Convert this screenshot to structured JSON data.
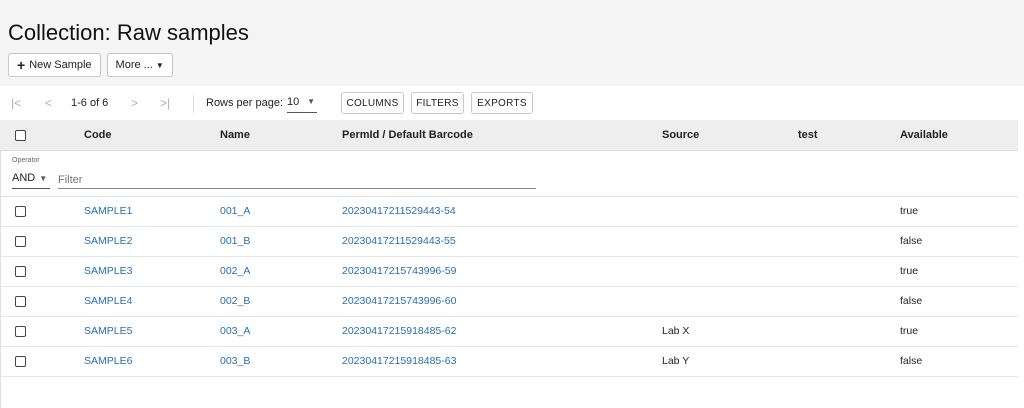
{
  "page": {
    "title": "Collection: Raw samples",
    "new_sample_label": "New Sample",
    "more_label": "More ..."
  },
  "pagination": {
    "first_icon": "first-page-icon",
    "prev_icon": "previous-page-icon",
    "next_icon": "next-page-icon",
    "last_icon": "last-page-icon",
    "range": "1-6 of 6",
    "rows_per_page_label": "Rows per page:",
    "rows_per_page_value": "10"
  },
  "toolbar": {
    "columns_label": "COLUMNS",
    "filters_label": "FILTERS",
    "exports_label": "EXPORTS"
  },
  "table": {
    "headers": {
      "code": "Code",
      "name": "Name",
      "permid": "PermId / Default Barcode",
      "source": "Source",
      "test": "test",
      "available": "Available"
    },
    "filter": {
      "operator_label": "Operator",
      "operator_value": "AND",
      "placeholder": "Filter"
    },
    "rows": [
      {
        "code": "SAMPLE1",
        "name": "001_A",
        "permid": "20230417211529443-54",
        "source": "",
        "test": "",
        "available": "true"
      },
      {
        "code": "SAMPLE2",
        "name": "001_B",
        "permid": "20230417211529443-55",
        "source": "",
        "test": "",
        "available": "false"
      },
      {
        "code": "SAMPLE3",
        "name": "002_A",
        "permid": "20230417215743996-59",
        "source": "",
        "test": "",
        "available": "true"
      },
      {
        "code": "SAMPLE4",
        "name": "002_B",
        "permid": "20230417215743996-60",
        "source": "",
        "test": "",
        "available": "false"
      },
      {
        "code": "SAMPLE5",
        "name": "003_A",
        "permid": "20230417215918485-62",
        "source": "Lab X",
        "test": "",
        "available": "true"
      },
      {
        "code": "SAMPLE6",
        "name": "003_B",
        "permid": "20230417215918485-63",
        "source": "Lab Y",
        "test": "",
        "available": "false"
      }
    ]
  },
  "colors": {
    "header_bg": "#f5f5f5",
    "table_header_bg": "#eeeeee",
    "link": "#2a6fb0"
  }
}
